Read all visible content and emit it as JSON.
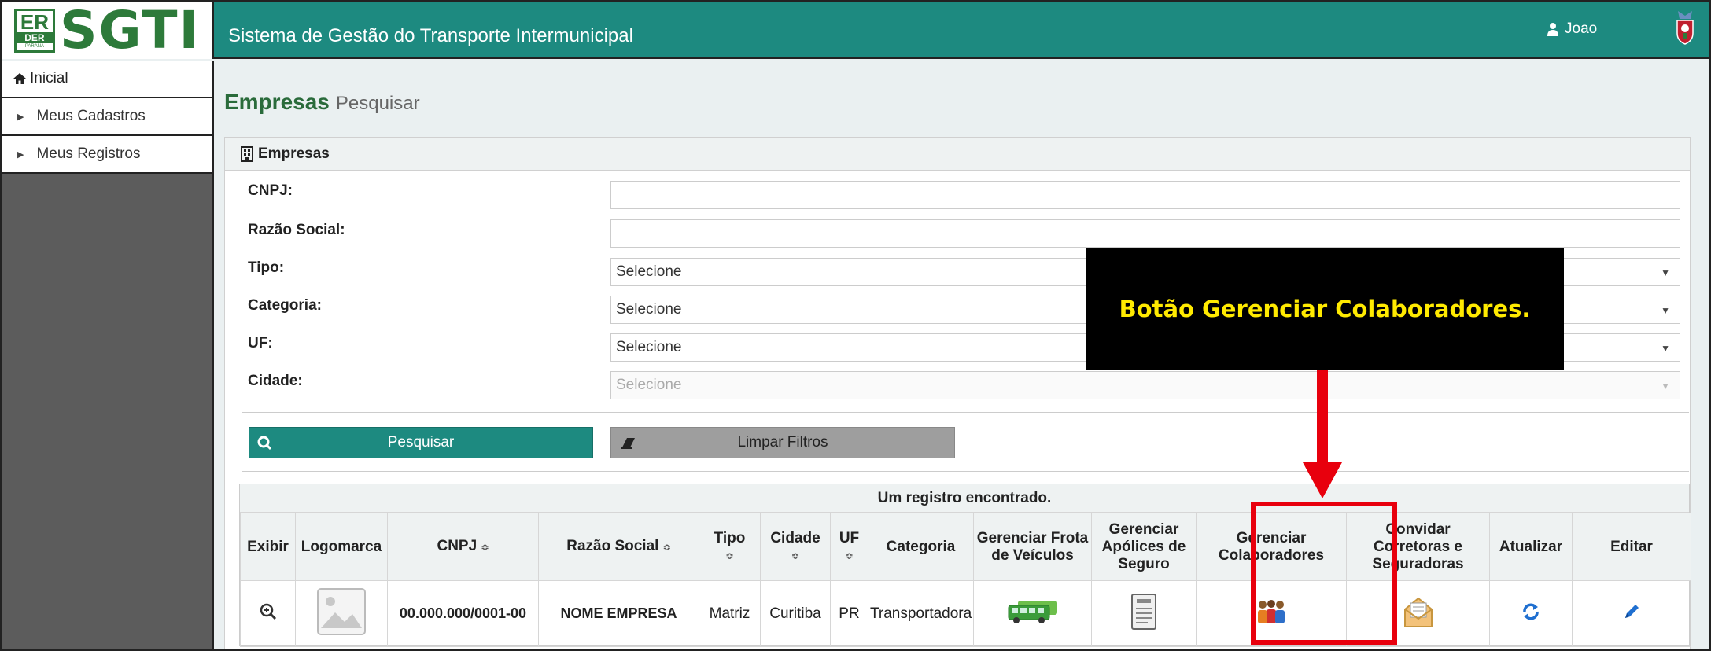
{
  "header": {
    "logo_text": "SGTI",
    "logo_emblem": {
      "top": "ER",
      "middle": "DER",
      "bottom": "PARANÁ"
    },
    "title": "Sistema de Gestão do Transporte Intermunicipal",
    "user_name": "Joao",
    "icons": {
      "user": "user-icon",
      "crest": "state-crest-icon"
    }
  },
  "sidebar": {
    "items": [
      {
        "label": "Inicial",
        "icon": "home-icon"
      },
      {
        "label": "Meus Cadastros",
        "icon": "chevron-right-icon"
      },
      {
        "label": "Meus Registros",
        "icon": "chevron-right-icon"
      }
    ]
  },
  "page": {
    "title": "Empresas",
    "subtitle": "Pesquisar"
  },
  "panel": {
    "title": "Empresas",
    "icon": "building-icon",
    "fields": {
      "cnpj": {
        "label": "CNPJ:",
        "value": ""
      },
      "razao": {
        "label": "Razão Social:",
        "value": ""
      },
      "tipo": {
        "label": "Tipo:",
        "value": "Selecione"
      },
      "categoria": {
        "label": "Categoria:",
        "value": "Selecione"
      },
      "uf": {
        "label": "UF:",
        "value": "Selecione"
      },
      "cidade": {
        "label": "Cidade:",
        "value": "Selecione"
      }
    },
    "buttons": {
      "search": "Pesquisar",
      "clear": "Limpar Filtros"
    }
  },
  "results": {
    "caption": "Um registro encontrado.",
    "columns": [
      "Exibir",
      "Logomarca",
      "CNPJ",
      "Razão Social",
      "Tipo",
      "Cidade",
      "UF",
      "Categoria",
      "Gerenciar Frota de Veículos",
      "Gerenciar Apólices de Seguro",
      "Gerenciar Colaboradores",
      "Convidar Corretoras e Seguradoras",
      "Atualizar",
      "Editar"
    ],
    "sort_glyph": "≎",
    "row": {
      "cnpj": "00.000.000/0001-00",
      "razao": "NOME EMPRESA",
      "tipo": "Matriz",
      "cidade": "Curitiba",
      "uf": "PR",
      "categoria": "Transportadora"
    }
  },
  "annotation": {
    "callout": "Botão Gerenciar Colaboradores.",
    "colors": {
      "highlight": "#e8000d",
      "callout_text": "#ffea00"
    }
  },
  "colors": {
    "primary": "#1d8a80",
    "heading": "#2a6b3b",
    "sidebar": "#5c5c5c"
  }
}
